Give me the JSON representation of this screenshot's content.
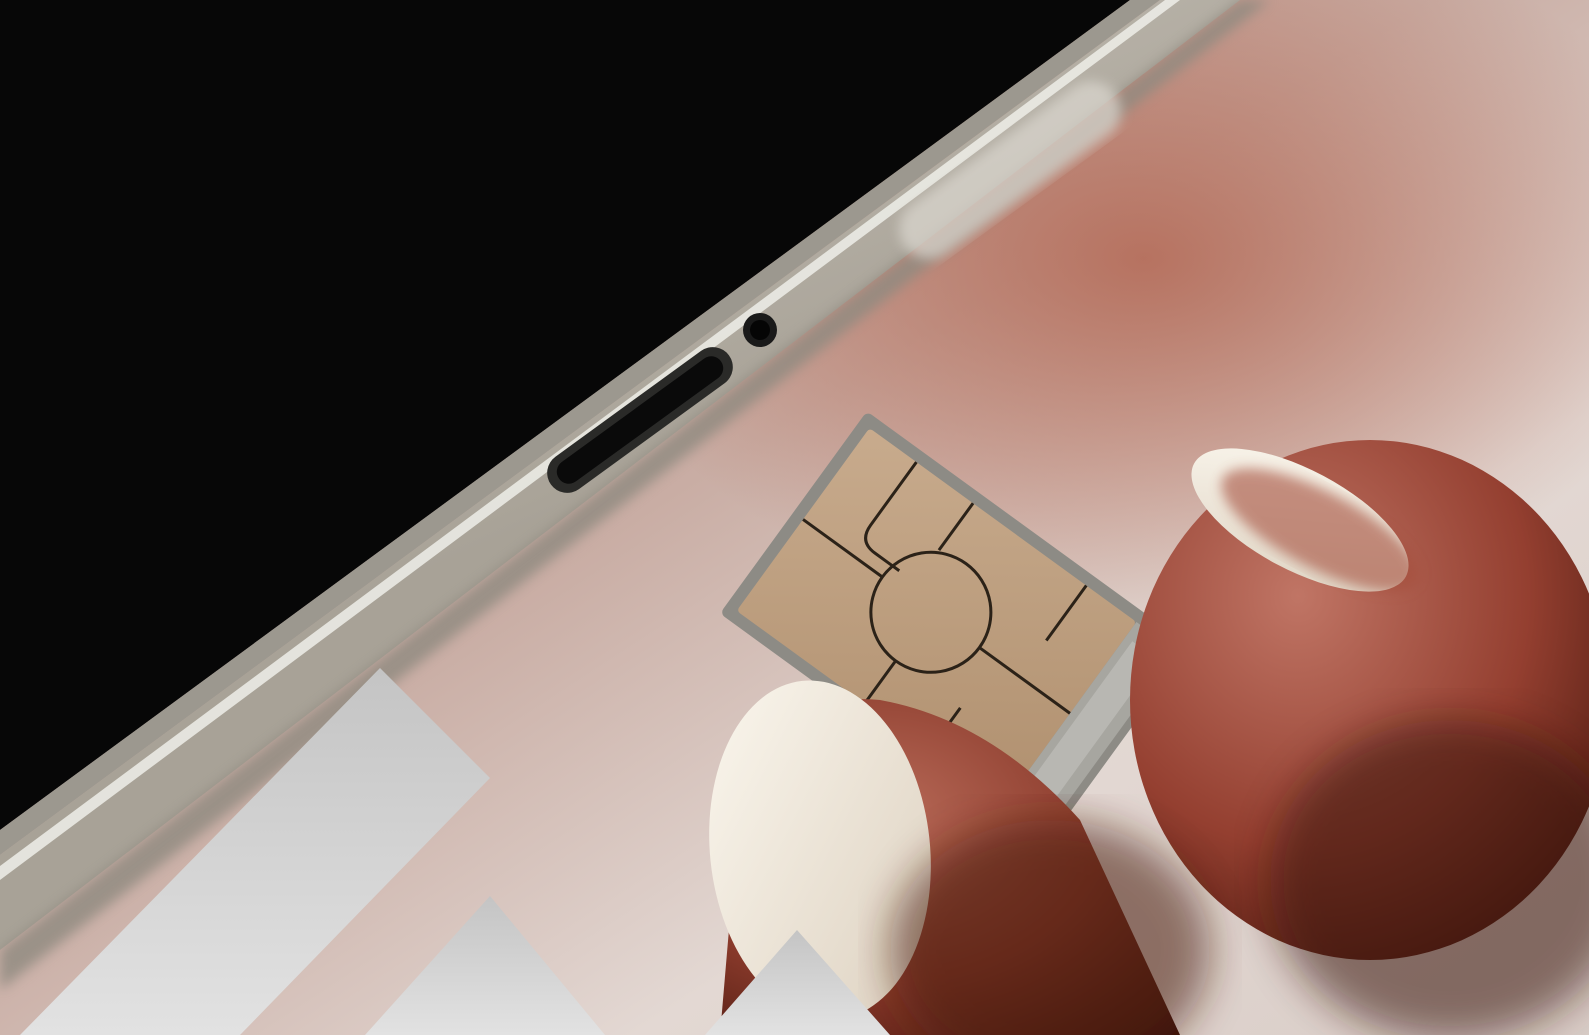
{
  "scene": {
    "subject": "sim-card-tray-insertion",
    "colors": {
      "background_light": "#e8ddd8",
      "background_warm": "#b98a7c",
      "phone_screen": "#050505",
      "phone_frame": "#c9c5bd",
      "frame_highlight": "#eeede8",
      "sim_gold": "#c4a486",
      "tray_metal": "#9a9994",
      "skin": "#a85f4e",
      "skin_shadow": "#5e2216",
      "nail": "#efe7d9",
      "overlay_shape": "#d2d2d2"
    }
  }
}
